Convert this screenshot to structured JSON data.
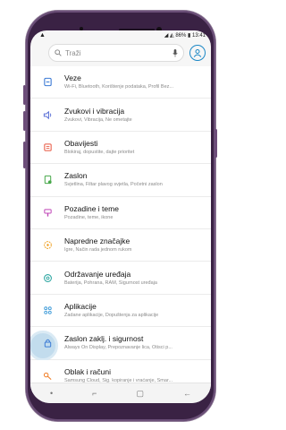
{
  "status": {
    "left_icon": "triangle-notification-icon",
    "battery": "86%",
    "time": "13:41"
  },
  "search": {
    "placeholder": "Traži"
  },
  "items": [
    {
      "title": "Veze",
      "subtitle": "Wi-Fi, Bluetooth, Korištenje podataka, Profil Bez...",
      "icon": "connections-icon",
      "color": "#3c7bd5"
    },
    {
      "title": "Zvukovi i vibracija",
      "subtitle": "Zvukovi, Vibracija, Ne ometajte",
      "icon": "speaker-icon",
      "color": "#5a6fd6"
    },
    {
      "title": "Obavijesti",
      "subtitle": "Blokiraj, dopustite, dajte prioritet",
      "icon": "notifications-icon",
      "color": "#e8553e"
    },
    {
      "title": "Zaslon",
      "subtitle": "Svjetlina, Filtar plavog svjetla, Početni zaslon",
      "icon": "display-icon",
      "color": "#48a84b"
    },
    {
      "title": "Pozadine i teme",
      "subtitle": "Pozadine, teme, ikone",
      "icon": "brush-icon",
      "color": "#c048b8"
    },
    {
      "title": "Napredne značajke",
      "subtitle": "Igre, Način rada jednom rukom",
      "icon": "advanced-gear-icon",
      "color": "#f0a020"
    },
    {
      "title": "Održavanje uređaja",
      "subtitle": "Baterija, Pohrana, RAM, Sigurnost uređaja",
      "icon": "maintenance-icon",
      "color": "#2aa5a0"
    },
    {
      "title": "Aplikacije",
      "subtitle": "Zadane aplikacije, Dopuštenja za aplikacije",
      "icon": "apps-grid-icon",
      "color": "#3c9ad8"
    },
    {
      "title": "Zaslon zaklj. i sigurnost",
      "subtitle": "Always On Display, Prepoznavanje lica, Otisci p...",
      "icon": "lock-icon",
      "color": "#3c7bd5"
    },
    {
      "title": "Oblak i računi",
      "subtitle": "Samsung Cloud, Sig. kopiranje i vraćanje, Smar...",
      "icon": "key-icon",
      "color": "#f07a20"
    }
  ],
  "navbar": {
    "dot": "•",
    "recents": "⌐",
    "home": "▢",
    "back": "←"
  }
}
